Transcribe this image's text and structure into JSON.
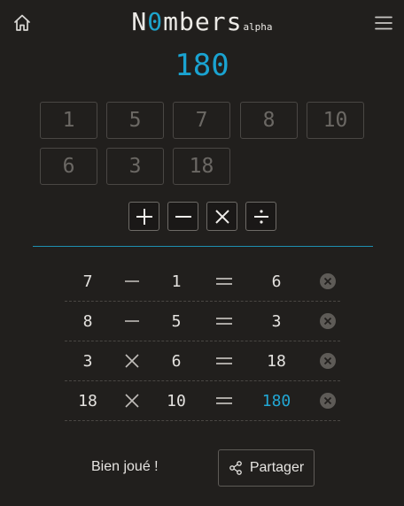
{
  "header": {
    "logo_prefix": "N",
    "logo_zero": "0",
    "logo_suffix": "mbers",
    "logo_sub": "alpha",
    "home_icon": "home-icon",
    "menu_icon": "hamburger-menu-icon"
  },
  "target": "180",
  "tiles": [
    "1",
    "5",
    "7",
    "8",
    "10",
    "6",
    "3",
    "18"
  ],
  "operators": [
    {
      "name": "plus",
      "icon": "plus-icon"
    },
    {
      "name": "minus",
      "icon": "minus-icon"
    },
    {
      "name": "times",
      "icon": "times-icon"
    },
    {
      "name": "divide",
      "icon": "divide-icon"
    }
  ],
  "operations": [
    {
      "a": "7",
      "op": "minus",
      "b": "1",
      "result": "6"
    },
    {
      "a": "8",
      "op": "minus",
      "b": "5",
      "result": "3"
    },
    {
      "a": "3",
      "op": "times",
      "b": "6",
      "result": "18"
    },
    {
      "a": "18",
      "op": "times",
      "b": "10",
      "result": "180"
    }
  ],
  "footer": {
    "status": "Bien joué !",
    "share_label": "Partager",
    "share_icon": "share-icon"
  },
  "colors": {
    "background": "#211f1d",
    "accent": "#1aa3d1",
    "tile_text": "#6b6864",
    "text": "#e8e6e3"
  }
}
